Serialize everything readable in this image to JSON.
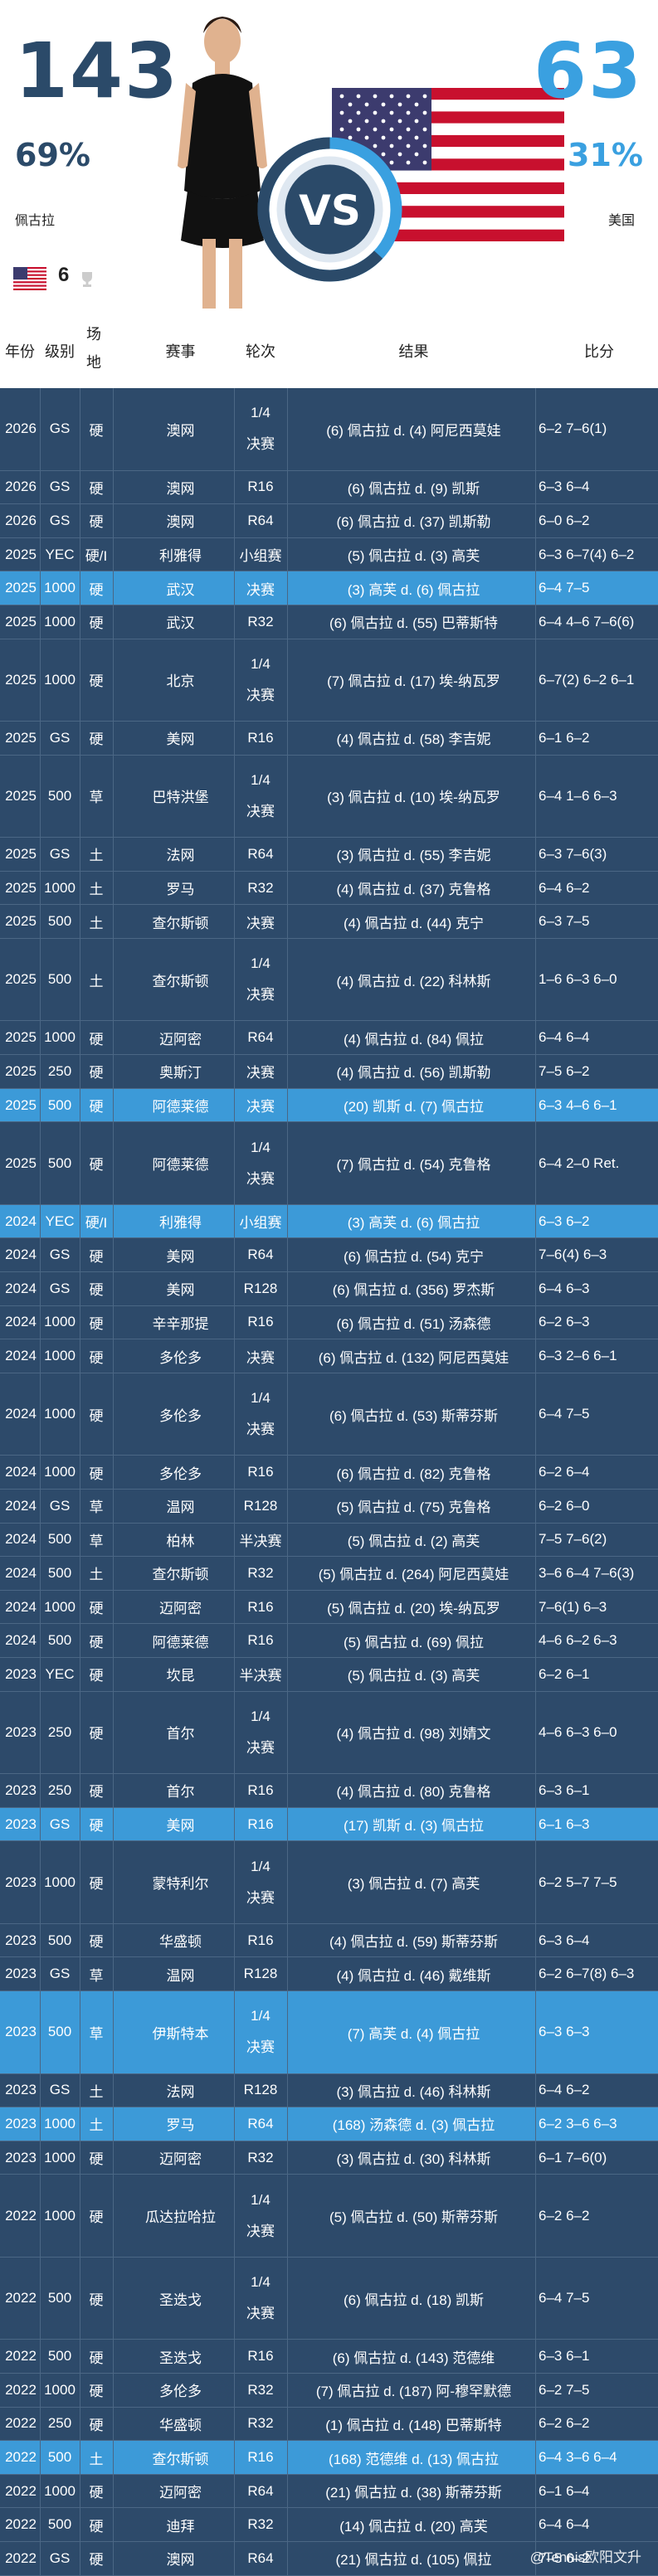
{
  "header": {
    "left_score": "143",
    "right_score": "63",
    "left_pct": "69%",
    "right_pct": "31%",
    "left_name": "佩古拉",
    "right_name": "美国",
    "titles_count": "6",
    "vs_label": "VS",
    "colors": {
      "left": "#2b4a69",
      "right": "#3aa0e0"
    }
  },
  "columns": {
    "year": "年份",
    "level": "级别",
    "surface": "场地",
    "event": "赛事",
    "round": "轮次",
    "result": "结果",
    "score": "比分"
  },
  "rows": [
    {
      "year": "2026",
      "level": "GS",
      "surface": "硬",
      "event": "澳网",
      "round": "1/4决赛",
      "result": "(6) 佩古拉 d. (4) 阿尼西莫娃",
      "score": "6–2 7–6(1)",
      "hl": false
    },
    {
      "year": "2026",
      "level": "GS",
      "surface": "硬",
      "event": "澳网",
      "round": "R16",
      "result": "(6) 佩古拉 d. (9) 凯斯",
      "score": "6–3 6–4",
      "hl": false
    },
    {
      "year": "2026",
      "level": "GS",
      "surface": "硬",
      "event": "澳网",
      "round": "R64",
      "result": "(6) 佩古拉 d. (37) 凯斯勒",
      "score": "6–0 6–2",
      "hl": false
    },
    {
      "year": "2025",
      "level": "YEC",
      "surface": "硬/I",
      "event": "利雅得",
      "round": "小组赛",
      "result": "(5) 佩古拉 d. (3) 高芙",
      "score": "6–3 6–7(4) 6–2",
      "hl": false
    },
    {
      "year": "2025",
      "level": "1000",
      "surface": "硬",
      "event": "武汉",
      "round": "决赛",
      "result": "(3) 高芙 d. (6) 佩古拉",
      "score": "6–4 7–5",
      "hl": true
    },
    {
      "year": "2025",
      "level": "1000",
      "surface": "硬",
      "event": "武汉",
      "round": "R32",
      "result": "(6) 佩古拉 d. (55) 巴蒂斯特",
      "score": "6–4 4–6 7–6(6)",
      "hl": false
    },
    {
      "year": "2025",
      "level": "1000",
      "surface": "硬",
      "event": "北京",
      "round": "1/4决赛",
      "result": "(7) 佩古拉 d. (17) 埃-纳瓦罗",
      "score": "6–7(2) 6–2 6–1",
      "hl": false
    },
    {
      "year": "2025",
      "level": "GS",
      "surface": "硬",
      "event": "美网",
      "round": "R16",
      "result": "(4) 佩古拉 d. (58) 李吉妮",
      "score": "6–1 6–2",
      "hl": false
    },
    {
      "year": "2025",
      "level": "500",
      "surface": "草",
      "event": "巴特洪堡",
      "round": "1/4决赛",
      "result": "(3) 佩古拉 d. (10) 埃-纳瓦罗",
      "score": "6–4 1–6 6–3",
      "hl": false
    },
    {
      "year": "2025",
      "level": "GS",
      "surface": "土",
      "event": "法网",
      "round": "R64",
      "result": "(3) 佩古拉 d. (55) 李吉妮",
      "score": "6–3 7–6(3)",
      "hl": false
    },
    {
      "year": "2025",
      "level": "1000",
      "surface": "土",
      "event": "罗马",
      "round": "R32",
      "result": "(4) 佩古拉 d. (37) 克鲁格",
      "score": "6–4 6–2",
      "hl": false
    },
    {
      "year": "2025",
      "level": "500",
      "surface": "土",
      "event": "查尔斯顿",
      "round": "决赛",
      "result": "(4) 佩古拉 d. (44) 克宁",
      "score": "6–3 7–5",
      "hl": false
    },
    {
      "year": "2025",
      "level": "500",
      "surface": "土",
      "event": "查尔斯顿",
      "round": "1/4决赛",
      "result": "(4) 佩古拉 d. (22) 科林斯",
      "score": "1–6 6–3 6–0",
      "hl": false
    },
    {
      "year": "2025",
      "level": "1000",
      "surface": "硬",
      "event": "迈阿密",
      "round": "R64",
      "result": "(4) 佩古拉 d. (84) 佩拉",
      "score": "6–4 6–4",
      "hl": false
    },
    {
      "year": "2025",
      "level": "250",
      "surface": "硬",
      "event": "奥斯汀",
      "round": "决赛",
      "result": "(4) 佩古拉 d. (56) 凯斯勒",
      "score": "7–5 6–2",
      "hl": false
    },
    {
      "year": "2025",
      "level": "500",
      "surface": "硬",
      "event": "阿德莱德",
      "round": "决赛",
      "result": "(20) 凯斯 d. (7) 佩古拉",
      "score": "6–3 4–6 6–1",
      "hl": true
    },
    {
      "year": "2025",
      "level": "500",
      "surface": "硬",
      "event": "阿德莱德",
      "round": "1/4决赛",
      "result": "(7) 佩古拉 d. (54) 克鲁格",
      "score": "6–4 2–0 Ret.",
      "hl": false
    },
    {
      "year": "2024",
      "level": "YEC",
      "surface": "硬/I",
      "event": "利雅得",
      "round": "小组赛",
      "result": "(3) 高芙 d. (6) 佩古拉",
      "score": "6–3 6–2",
      "hl": true
    },
    {
      "year": "2024",
      "level": "GS",
      "surface": "硬",
      "event": "美网",
      "round": "R64",
      "result": "(6) 佩古拉 d. (54) 克宁",
      "score": "7–6(4) 6–3",
      "hl": false
    },
    {
      "year": "2024",
      "level": "GS",
      "surface": "硬",
      "event": "美网",
      "round": "R128",
      "result": "(6) 佩古拉 d. (356) 罗杰斯",
      "score": "6–4 6–3",
      "hl": false
    },
    {
      "year": "2024",
      "level": "1000",
      "surface": "硬",
      "event": "辛辛那提",
      "round": "R16",
      "result": "(6) 佩古拉 d. (51) 汤森德",
      "score": "6–2 6–3",
      "hl": false
    },
    {
      "year": "2024",
      "level": "1000",
      "surface": "硬",
      "event": "多伦多",
      "round": "决赛",
      "result": "(6) 佩古拉 d. (132) 阿尼西莫娃",
      "score": "6–3 2–6 6–1",
      "hl": false
    },
    {
      "year": "2024",
      "level": "1000",
      "surface": "硬",
      "event": "多伦多",
      "round": "1/4决赛",
      "result": "(6) 佩古拉 d. (53) 斯蒂芬斯",
      "score": "6–4 7–5",
      "hl": false
    },
    {
      "year": "2024",
      "level": "1000",
      "surface": "硬",
      "event": "多伦多",
      "round": "R16",
      "result": "(6) 佩古拉 d. (82) 克鲁格",
      "score": "6–2 6–4",
      "hl": false
    },
    {
      "year": "2024",
      "level": "GS",
      "surface": "草",
      "event": "温网",
      "round": "R128",
      "result": "(5) 佩古拉 d. (75) 克鲁格",
      "score": "6–2 6–0",
      "hl": false
    },
    {
      "year": "2024",
      "level": "500",
      "surface": "草",
      "event": "柏林",
      "round": "半决赛",
      "result": "(5) 佩古拉 d. (2) 高芙",
      "score": "7–5 7–6(2)",
      "hl": false
    },
    {
      "year": "2024",
      "level": "500",
      "surface": "土",
      "event": "查尔斯顿",
      "round": "R32",
      "result": "(5) 佩古拉 d. (264) 阿尼西莫娃",
      "score": "3–6 6–4 7–6(3)",
      "hl": false
    },
    {
      "year": "2024",
      "level": "1000",
      "surface": "硬",
      "event": "迈阿密",
      "round": "R16",
      "result": "(5) 佩古拉 d. (20) 埃-纳瓦罗",
      "score": "7–6(1) 6–3",
      "hl": false
    },
    {
      "year": "2024",
      "level": "500",
      "surface": "硬",
      "event": "阿德莱德",
      "round": "R16",
      "result": "(5) 佩古拉 d. (69) 佩拉",
      "score": "4–6 6–2 6–3",
      "hl": false
    },
    {
      "year": "2023",
      "level": "YEC",
      "surface": "硬",
      "event": "坎昆",
      "round": "半决赛",
      "result": "(5) 佩古拉 d. (3) 高芙",
      "score": "6–2 6–1",
      "hl": false
    },
    {
      "year": "2023",
      "level": "250",
      "surface": "硬",
      "event": "首尔",
      "round": "1/4决赛",
      "result": "(4) 佩古拉 d. (98) 刘婧文",
      "score": "4–6 6–3 6–0",
      "hl": false
    },
    {
      "year": "2023",
      "level": "250",
      "surface": "硬",
      "event": "首尔",
      "round": "R16",
      "result": "(4) 佩古拉 d. (80) 克鲁格",
      "score": "6–3 6–1",
      "hl": false
    },
    {
      "year": "2023",
      "level": "GS",
      "surface": "硬",
      "event": "美网",
      "round": "R16",
      "result": "(17) 凯斯 d. (3) 佩古拉",
      "score": "6–1 6–3",
      "hl": true
    },
    {
      "year": "2023",
      "level": "1000",
      "surface": "硬",
      "event": "蒙特利尔",
      "round": "1/4决赛",
      "result": "(3) 佩古拉 d. (7) 高芙",
      "score": "6–2 5–7 7–5",
      "hl": false
    },
    {
      "year": "2023",
      "level": "500",
      "surface": "硬",
      "event": "华盛顿",
      "round": "R16",
      "result": "(4) 佩古拉 d. (59) 斯蒂芬斯",
      "score": "6–3 6–4",
      "hl": false
    },
    {
      "year": "2023",
      "level": "GS",
      "surface": "草",
      "event": "温网",
      "round": "R128",
      "result": "(4) 佩古拉 d. (46) 戴维斯",
      "score": "6–2 6–7(8) 6–3",
      "hl": false
    },
    {
      "year": "2023",
      "level": "500",
      "surface": "草",
      "event": "伊斯特本",
      "round": "1/4决赛",
      "result": "(7) 高芙 d. (4) 佩古拉",
      "score": "6–3 6–3",
      "hl": true
    },
    {
      "year": "2023",
      "level": "GS",
      "surface": "土",
      "event": "法网",
      "round": "R128",
      "result": "(3) 佩古拉 d. (46) 科林斯",
      "score": "6–4 6–2",
      "hl": false
    },
    {
      "year": "2023",
      "level": "1000",
      "surface": "土",
      "event": "罗马",
      "round": "R64",
      "result": "(168) 汤森德 d. (3) 佩古拉",
      "score": "6–2 3–6 6–3",
      "hl": true
    },
    {
      "year": "2023",
      "level": "1000",
      "surface": "硬",
      "event": "迈阿密",
      "round": "R32",
      "result": "(3) 佩古拉 d. (30) 科林斯",
      "score": "6–1 7–6(0)",
      "hl": false
    },
    {
      "year": "2022",
      "level": "1000",
      "surface": "硬",
      "event": "瓜达拉哈拉",
      "round": "1/4决赛",
      "result": "(5) 佩古拉 d. (50) 斯蒂芬斯",
      "score": "6–2 6–2",
      "hl": false
    },
    {
      "year": "2022",
      "level": "500",
      "surface": "硬",
      "event": "圣迭戈",
      "round": "1/4决赛",
      "result": "(6) 佩古拉 d. (18) 凯斯",
      "score": "6–4 7–5",
      "hl": false
    },
    {
      "year": "2022",
      "level": "500",
      "surface": "硬",
      "event": "圣迭戈",
      "round": "R16",
      "result": "(6) 佩古拉 d. (143) 范德维",
      "score": "6–3 6–1",
      "hl": false
    },
    {
      "year": "2022",
      "level": "1000",
      "surface": "硬",
      "event": "多伦多",
      "round": "R32",
      "result": "(7) 佩古拉 d. (187) 阿-穆罕默德",
      "score": "6–2 7–5",
      "hl": false
    },
    {
      "year": "2022",
      "level": "250",
      "surface": "硬",
      "event": "华盛顿",
      "round": "R32",
      "result": "(1) 佩古拉 d. (148) 巴蒂斯特",
      "score": "6–2 6–2",
      "hl": false
    },
    {
      "year": "2022",
      "level": "500",
      "surface": "土",
      "event": "查尔斯顿",
      "round": "R16",
      "result": "(168) 范德维 d. (13) 佩古拉",
      "score": "6–4 3–6 6–4",
      "hl": true
    },
    {
      "year": "2022",
      "level": "1000",
      "surface": "硬",
      "event": "迈阿密",
      "round": "R64",
      "result": "(21) 佩古拉 d. (38) 斯蒂芬斯",
      "score": "6–1 6–4",
      "hl": false
    },
    {
      "year": "2022",
      "level": "500",
      "surface": "硬",
      "event": "迪拜",
      "round": "R32",
      "result": "(14) 佩古拉 d. (20) 高芙",
      "score": "6–4 6–4",
      "hl": false
    },
    {
      "year": "2022",
      "level": "GS",
      "surface": "硬",
      "event": "澳网",
      "round": "R64",
      "result": "(21) 佩古拉 d. (105) 佩拉",
      "score": "7–5 6–2",
      "hl": false
    }
  ],
  "watermark": "@Tennis欧阳文升"
}
